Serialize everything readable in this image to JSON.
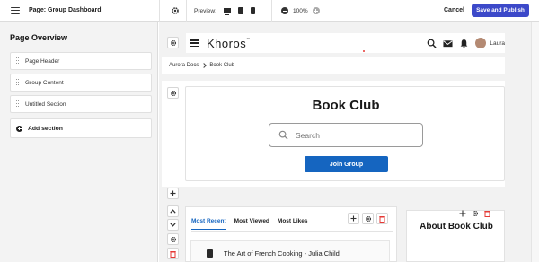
{
  "topbar": {
    "page_label": "Page: Group Dashboard",
    "preview_label": "Preview:",
    "zoom_value": "100%",
    "cancel_label": "Cancel",
    "publish_label": "Save and Publish"
  },
  "sidebar": {
    "title": "Page Overview",
    "items": [
      {
        "label": "Page Header"
      },
      {
        "label": "Group Content"
      },
      {
        "label": "Untitled Section"
      }
    ],
    "add_label": "Add section"
  },
  "header": {
    "logo": "Khoros",
    "user_name": "Laura"
  },
  "breadcrumb": {
    "root": "Aurora Docs",
    "current": "Book Club"
  },
  "hero": {
    "title": "Book Club",
    "search_placeholder": "Search",
    "join_label": "Join Group"
  },
  "content": {
    "tabs": [
      {
        "label": "Most Recent",
        "active": true
      },
      {
        "label": "Most Viewed",
        "active": false
      },
      {
        "label": "Most Likes",
        "active": false
      }
    ],
    "first_item_title": "The Art of French Cooking - Julia Child"
  },
  "about": {
    "title": "About Book Club"
  },
  "colors": {
    "accent": "#1565c0",
    "publish": "#3c49c9",
    "delete": "#e53935"
  }
}
